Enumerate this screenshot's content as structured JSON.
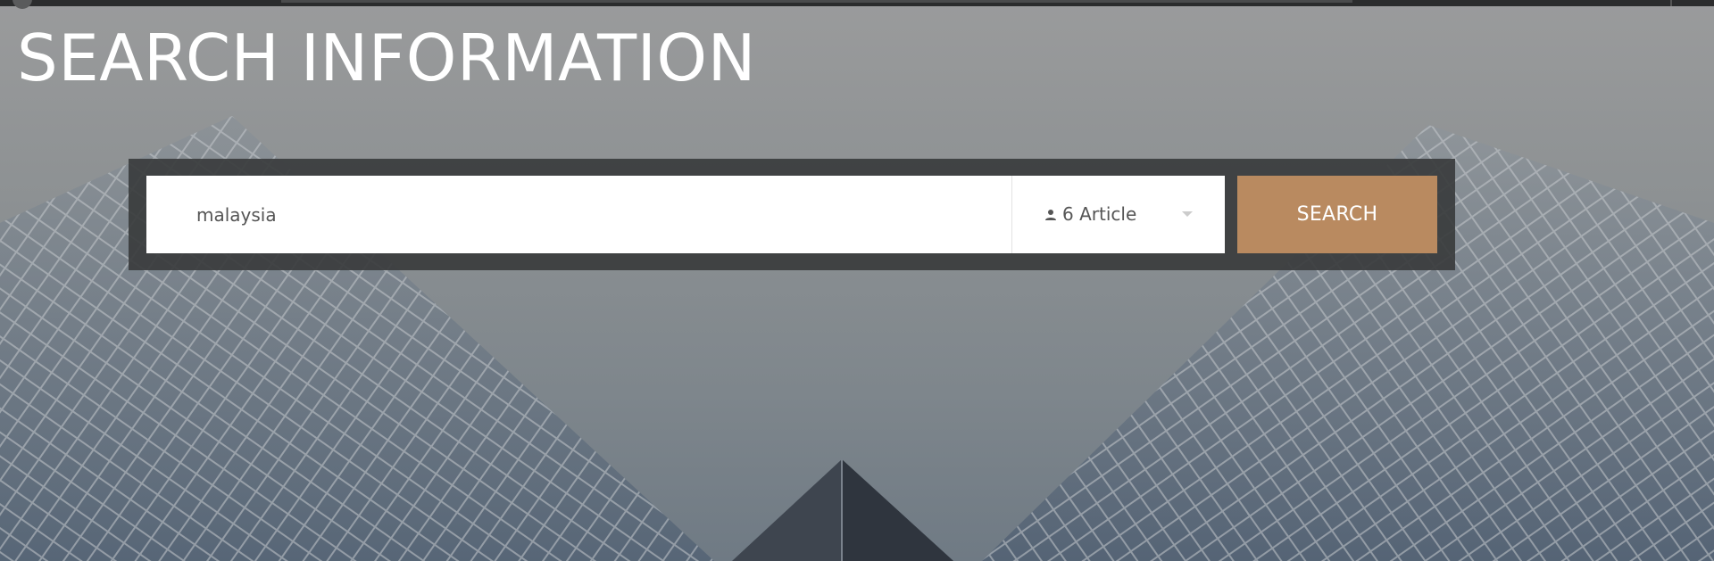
{
  "page": {
    "title": "SEARCH INFORMATION"
  },
  "search": {
    "query": "malaysia",
    "category_selected": "6 Article",
    "button_label": "SEARCH"
  },
  "icons": {
    "category": "user-icon",
    "dropdown": "chevron-down-icon"
  },
  "colors": {
    "accent": "#b98a60",
    "panel": "#3a3c3d",
    "title_text": "#ffffff"
  }
}
